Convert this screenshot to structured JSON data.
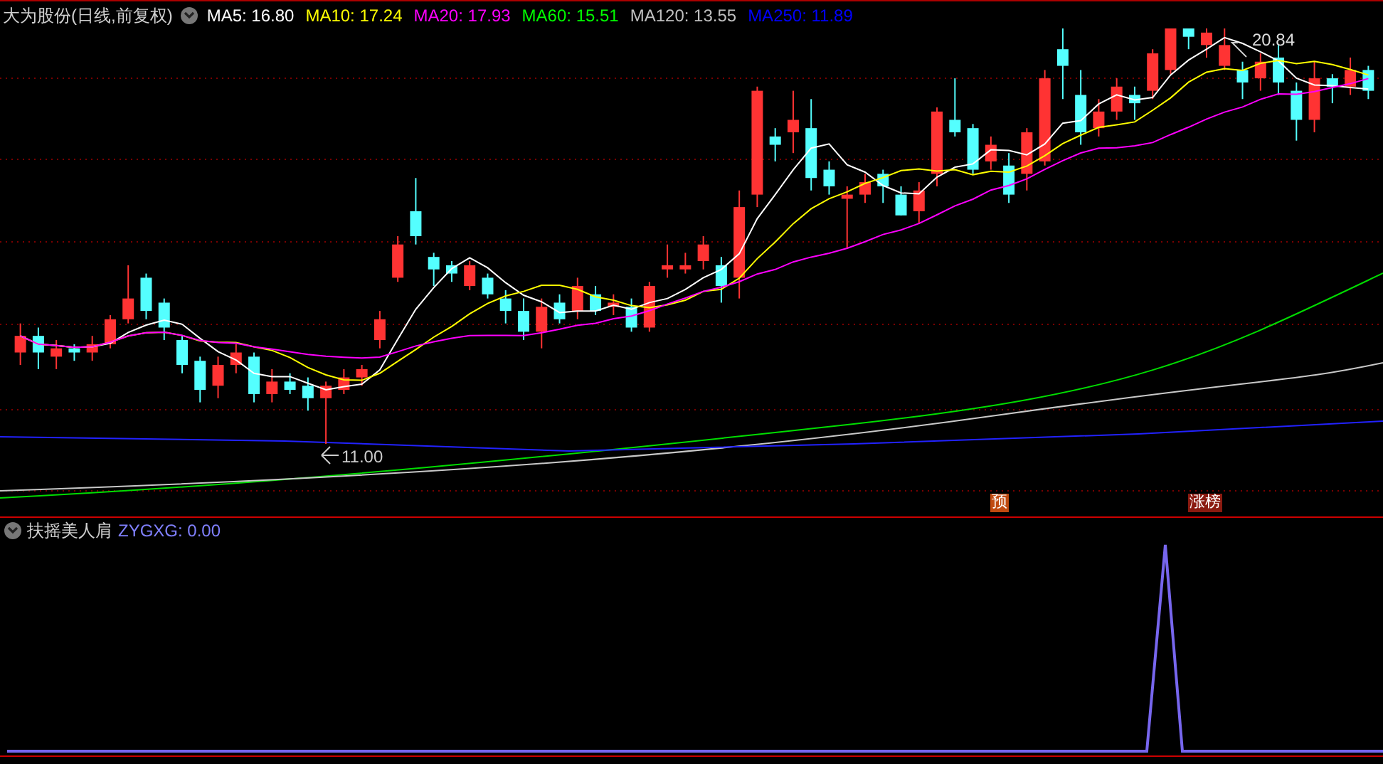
{
  "chart_header": {
    "title": "大为股份(日线,前复权)",
    "moving_averages": [
      {
        "label": "MA5: 16.80",
        "color": "#ffffff"
      },
      {
        "label": "MA10: 17.24",
        "color": "#ffff00"
      },
      {
        "label": "MA20: 17.93",
        "color": "#ff00ff"
      },
      {
        "label": "MA60: 15.51",
        "color": "#00ff00"
      },
      {
        "label": "MA120: 13.55",
        "color": "#c0c0c0"
      },
      {
        "label": "MA250: 11.89",
        "color": "#0000ff"
      }
    ]
  },
  "price_chart": {
    "high_label": "20.84",
    "low_label": "11.00",
    "markers": [
      {
        "text": "预",
        "color": "#c04a10"
      },
      {
        "text": "涨榜",
        "color": "#8a1a10"
      }
    ]
  },
  "indicator": {
    "title": "扶摇美人肩",
    "reading": "ZYGXG: 0.00"
  }
}
